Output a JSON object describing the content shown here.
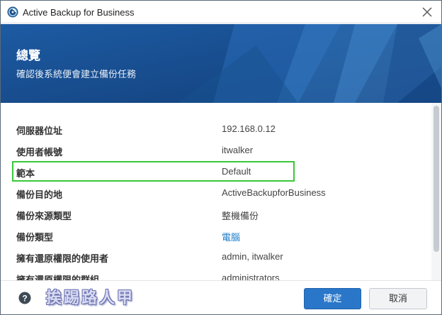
{
  "window": {
    "title": "Active Backup for Business",
    "icons": {
      "app": "active-backup-icon",
      "close": "close-icon"
    }
  },
  "banner": {
    "title": "總覽",
    "subtitle": "確認後系統便會建立備份任務"
  },
  "summary": {
    "rows": [
      {
        "key": "伺服器位址",
        "value": "192.168.0.12"
      },
      {
        "key": "使用者帳號",
        "value": "itwalker"
      },
      {
        "key": "範本",
        "value": "Default"
      },
      {
        "key": "備份目的地",
        "value": "ActiveBackupforBusiness"
      },
      {
        "key": "備份來源類型",
        "value": "整機備份"
      },
      {
        "key": "備份類型",
        "value": "電腦"
      },
      {
        "key": "擁有還原權限的使用者",
        "value": "admin, itwalker"
      },
      {
        "key": "擁有還原權限的群組",
        "value": "administrators"
      }
    ]
  },
  "footer": {
    "watermark": "挨踢路人甲",
    "confirm_label": "確定",
    "cancel_label": "取消",
    "icons": {
      "help": "help-icon"
    }
  },
  "colors": {
    "banner": "#1f5fa8",
    "primary_button": "#2a77c9",
    "highlight_border": "#39c83a",
    "link": "#1a7cc8"
  }
}
